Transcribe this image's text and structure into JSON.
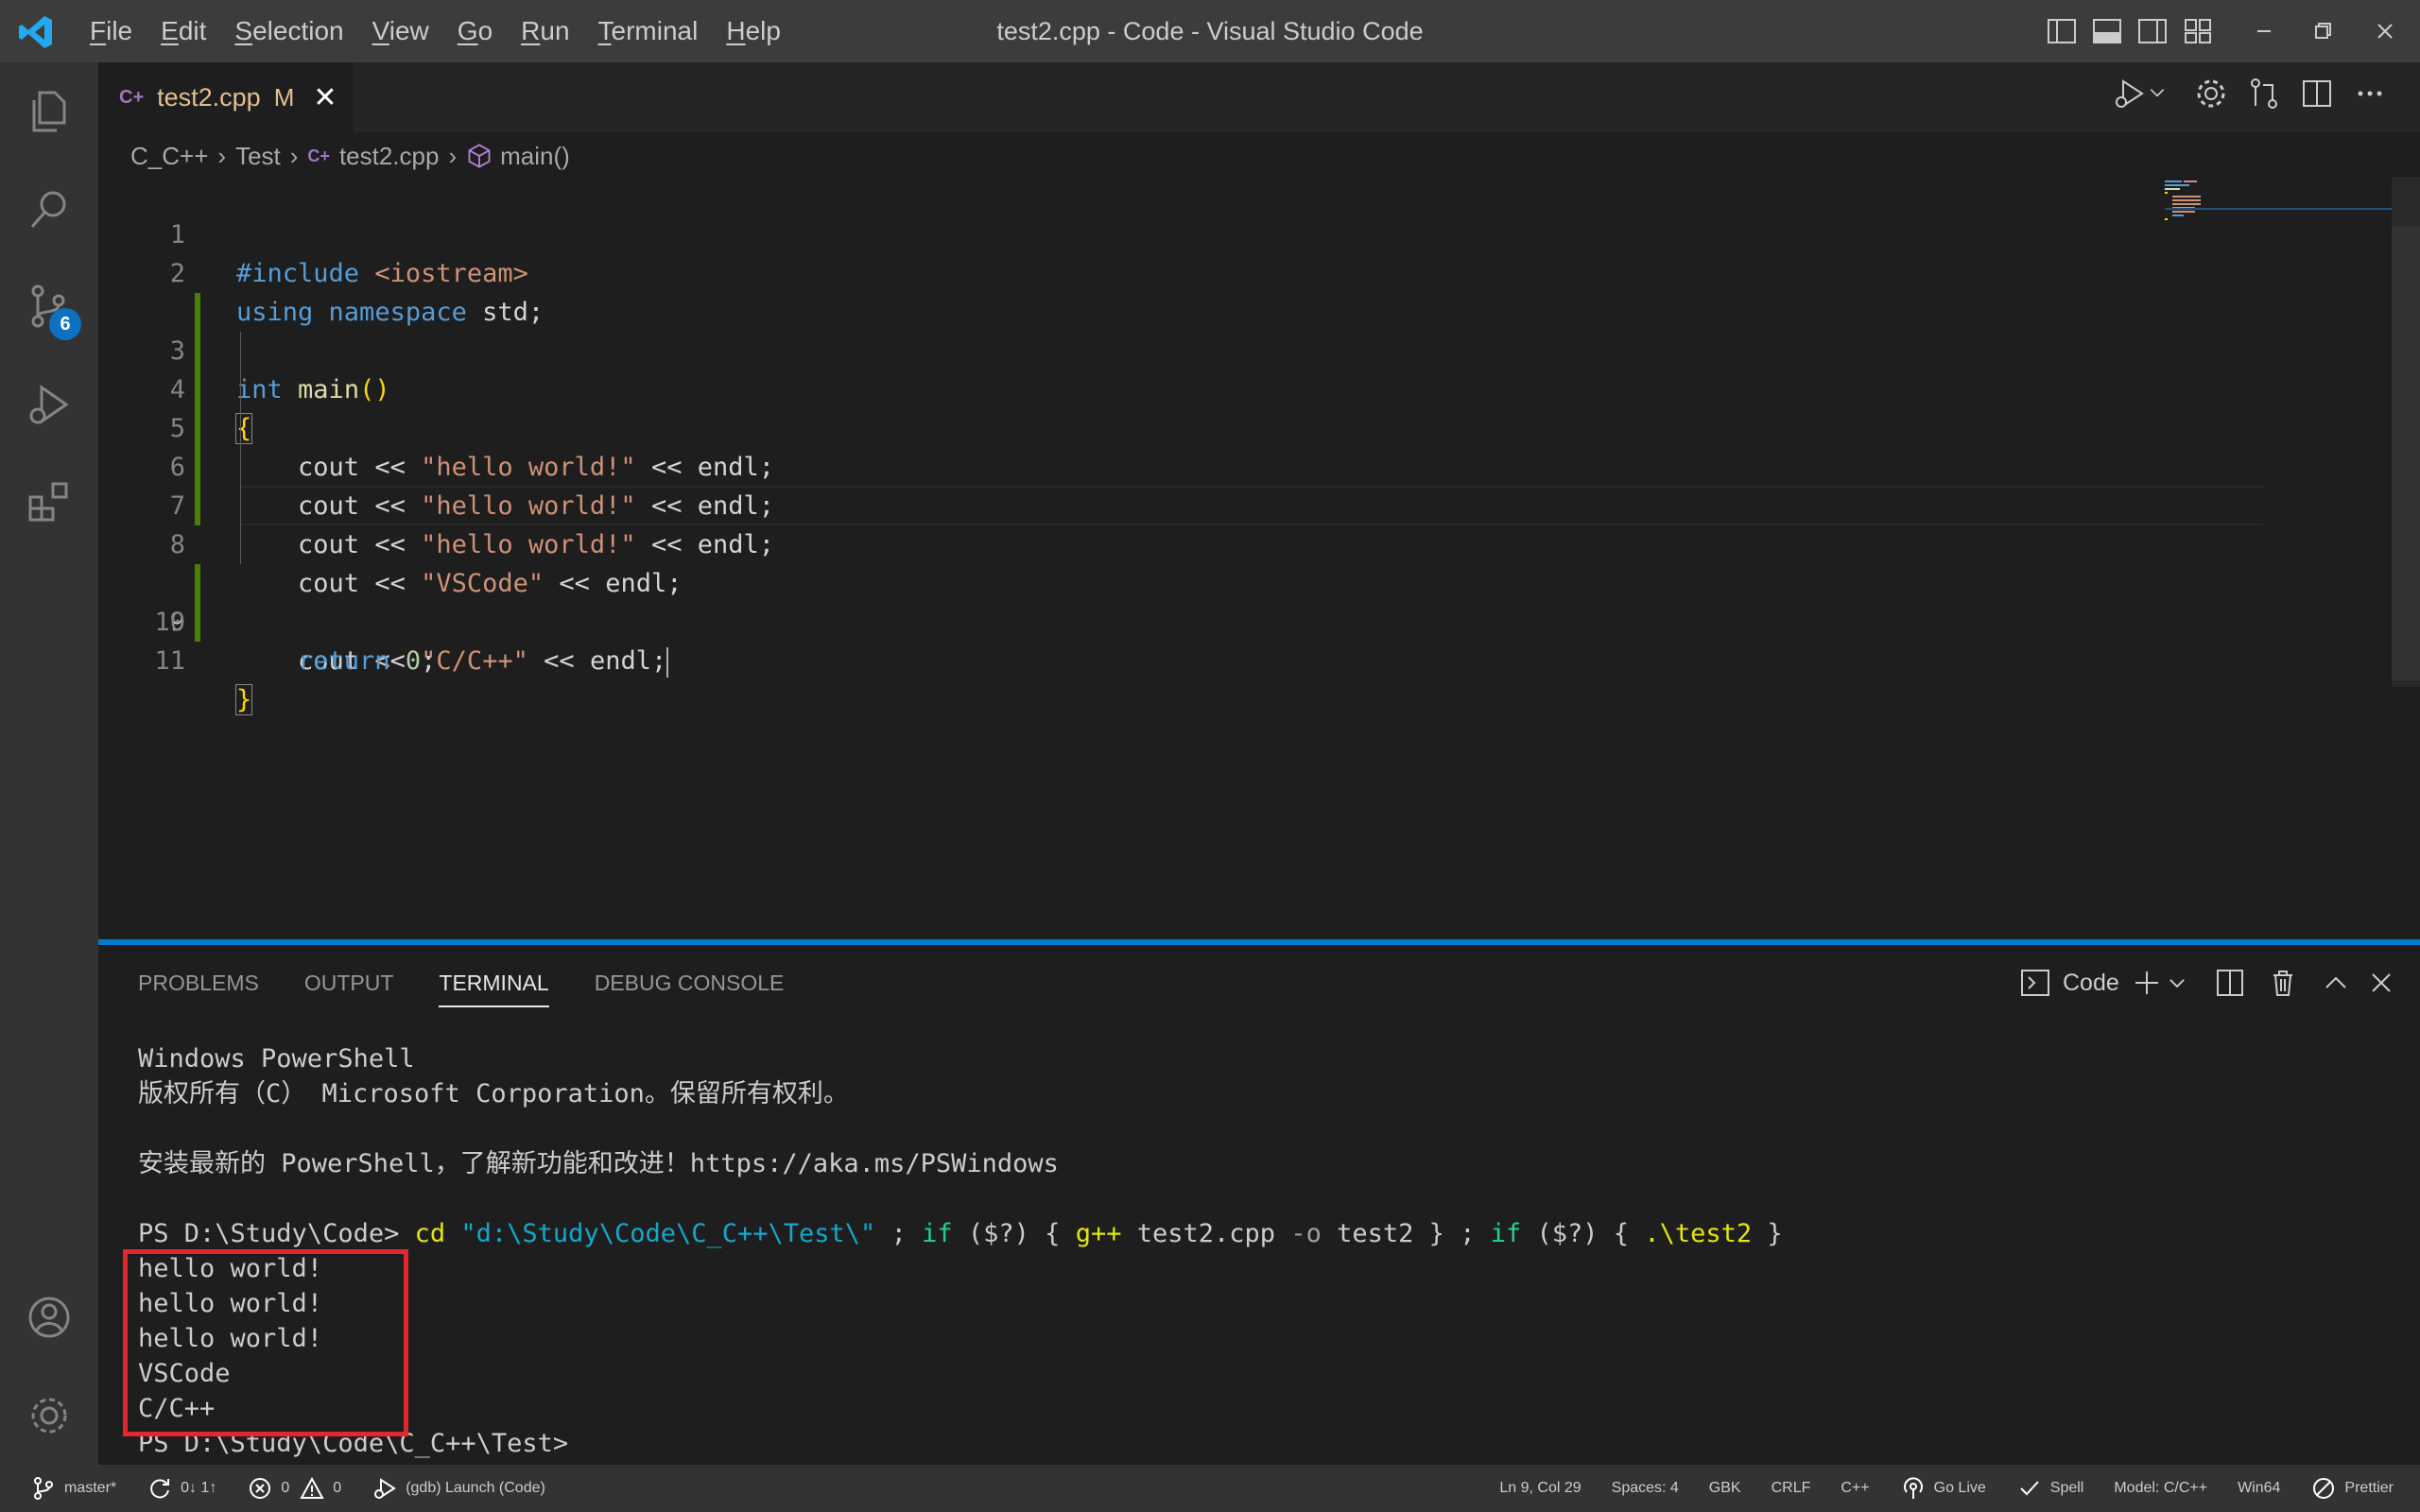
{
  "window": {
    "title": "test2.cpp - Code - Visual Studio Code",
    "menu": [
      {
        "hot": "F",
        "rest": "ile"
      },
      {
        "hot": "E",
        "rest": "dit"
      },
      {
        "hot": "S",
        "rest": "election"
      },
      {
        "hot": "V",
        "rest": "iew"
      },
      {
        "hot": "G",
        "rest": "o"
      },
      {
        "hot": "R",
        "rest": "un"
      },
      {
        "hot": "T",
        "rest": "erminal"
      },
      {
        "hot": "H",
        "rest": "elp"
      }
    ]
  },
  "activity_bar": {
    "source_control_badge": "6"
  },
  "editor": {
    "tab": {
      "icon_text": "C+",
      "filename": "test2.cpp",
      "status": "M"
    },
    "breadcrumb": {
      "items": [
        "C_C++",
        "Test",
        "test2.cpp",
        "main()"
      ]
    },
    "lines": [
      {
        "n": "1"
      },
      {
        "n": "2"
      },
      {
        "n": "3"
      },
      {
        "n": "4"
      },
      {
        "n": "5"
      },
      {
        "n": "6"
      },
      {
        "n": "7"
      },
      {
        "n": "8"
      },
      {
        "n": "9"
      },
      {
        "n": "10"
      },
      {
        "n": "11"
      }
    ],
    "code": {
      "l1_kw": "#include",
      "l1_str": "<iostream>",
      "l2_kw1": "using",
      "l2_kw2": "namespace",
      "l2_id": "std;",
      "l3_kw": "int",
      "l3_fn": "main",
      "l3_br": "()",
      "l4_br": "{",
      "cout": "cout",
      "op": "<<",
      "endl": "endl;",
      "s_hello": "\"hello world!\"",
      "s_vscode": "\"VSCode\"",
      "s_cpp": "\"C/C++\"",
      "l10_kw": "return",
      "l10_num": "0",
      "l10_semi": ";",
      "l11_br": "}"
    }
  },
  "panel": {
    "tabs": [
      "PROBLEMS",
      "OUTPUT",
      "TERMINAL",
      "DEBUG CONSOLE"
    ],
    "active_tab": "TERMINAL",
    "terminal_name": "Code",
    "terminal": {
      "line1": "Windows PowerShell",
      "line2": "版权所有（C） Microsoft Corporation。保留所有权利。",
      "line3": "安装最新的 PowerShell，了解新功能和改进！https://aka.ms/PSWindows",
      "prompt": "PS D:\\Study\\Code>",
      "cmd_cd": "cd",
      "cmd_path": "\"d:\\Study\\Code\\C_C++\\Test\\\"",
      "cmd_sep1": ";",
      "cmd_if": "if",
      "cmd_cond": "($?)",
      "cmd_open": "{",
      "cmd_gpp": "g++",
      "cmd_file": "test2.cpp",
      "cmd_flag": "-o",
      "cmd_out": "test2",
      "cmd_close": "}",
      "cmd_run": ".\\test2",
      "output": [
        "hello world!",
        "hello world!",
        "hello world!",
        "VSCode",
        "C/C++"
      ],
      "final_prompt": "PS D:\\Study\\Code\\C_C++\\Test>"
    }
  },
  "status_bar": {
    "branch": "master*",
    "sync": "0↓ 1↑",
    "errors": "0",
    "warnings": "0",
    "debug": "(gdb) Launch (Code)",
    "position": "Ln 9, Col 29",
    "spaces": "Spaces: 4",
    "encoding": "GBK",
    "eol": "CRLF",
    "language": "C++",
    "go_live": "Go Live",
    "spell": "Spell",
    "model": "Model: C/C++",
    "platform": "Win64",
    "prettier": "Prettier"
  },
  "colors": {
    "accent": "#007acc",
    "modified": "#e2c08d",
    "highlight_box": "#e0282e",
    "gutter_modified": "#487e02"
  }
}
